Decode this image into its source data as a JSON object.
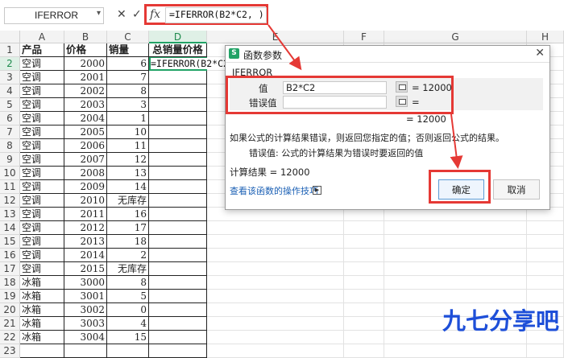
{
  "formula_bar": {
    "name_box": "IFERROR",
    "name_box_dropdown": "▾",
    "cancel_icon": "✕",
    "confirm_icon": "✓",
    "fx_label": "fx",
    "formula": "=IFERROR(B2*C2, )"
  },
  "columns": [
    "A",
    "B",
    "C",
    "D",
    "E",
    "F",
    "G",
    "H"
  ],
  "rows": [
    "1",
    "2",
    "3",
    "4",
    "5",
    "6",
    "7",
    "8",
    "9",
    "10",
    "11",
    "12",
    "13",
    "14",
    "15",
    "16",
    "17",
    "18",
    "19",
    "20",
    "21",
    "22",
    "23"
  ],
  "table": {
    "headers": [
      "产品",
      "价格",
      "销量",
      "总销量价格"
    ],
    "rows": [
      [
        "空调",
        "2000",
        "6"
      ],
      [
        "空调",
        "2001",
        "7"
      ],
      [
        "空调",
        "2002",
        "8"
      ],
      [
        "空调",
        "2003",
        "3"
      ],
      [
        "空调",
        "2004",
        "1"
      ],
      [
        "空调",
        "2005",
        "10"
      ],
      [
        "空调",
        "2006",
        "11"
      ],
      [
        "空调",
        "2007",
        "12"
      ],
      [
        "空调",
        "2008",
        "13"
      ],
      [
        "空调",
        "2009",
        "14"
      ],
      [
        "空调",
        "2010",
        "无库存"
      ],
      [
        "空调",
        "2011",
        "16"
      ],
      [
        "空调",
        "2012",
        "17"
      ],
      [
        "空调",
        "2013",
        "18"
      ],
      [
        "空调",
        "2014",
        "2"
      ],
      [
        "空调",
        "2015",
        "无库存"
      ],
      [
        "冰箱",
        "3000",
        "8"
      ],
      [
        "冰箱",
        "3001",
        "5"
      ],
      [
        "冰箱",
        "3002",
        "0"
      ],
      [
        "冰箱",
        "3003",
        "4"
      ],
      [
        "冰箱",
        "3004",
        "15"
      ]
    ],
    "editing_cell_text": "=IFERROR(B2*C2,"
  },
  "dialog": {
    "title": "函数参数",
    "logo": "S",
    "close": "✕",
    "function_name": "IFERROR",
    "arg1_label": "值",
    "arg1_value": "B2*C2",
    "arg1_result": "= 12000",
    "arg2_label": "错误值",
    "arg2_value": "",
    "arg2_result": "=",
    "overall_result": "= 12000",
    "description": "如果公式的计算结果错误，则返回您指定的值；否则返回公式的结果。",
    "arg_description": "错误值:  公式的计算结果为错误时要返回的值",
    "calc_result": "计算结果 = 12000",
    "help_link": "查看该函数的操作技巧",
    "ok": "确定",
    "cancel": "取消"
  },
  "watermark": "九七分享吧",
  "colors": {
    "annotation": "#e53935",
    "selection": "#21a366",
    "watermark": "#1e4fd8"
  }
}
